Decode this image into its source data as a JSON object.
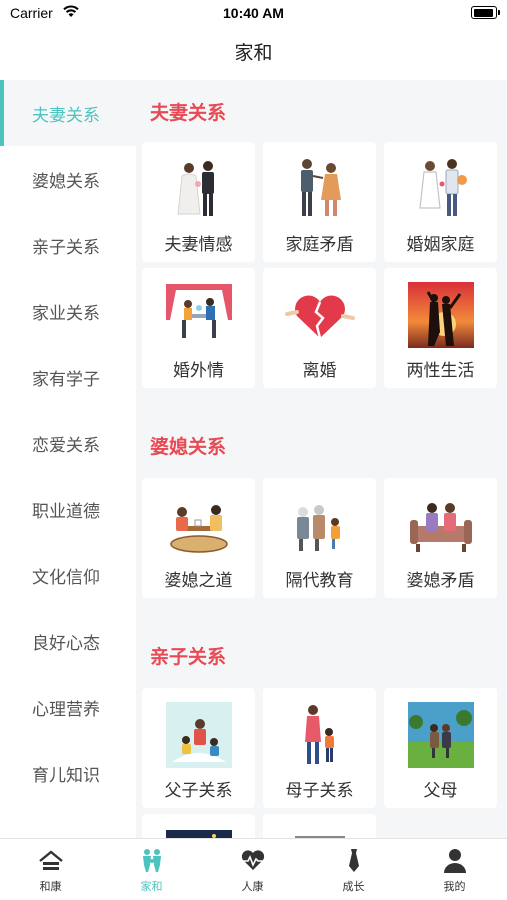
{
  "status": {
    "carrier": "Carrier",
    "time": "10:40 AM",
    "battery_level": 0.95
  },
  "nav": {
    "title": "家和"
  },
  "sidebar": {
    "active_index": 0,
    "items": [
      {
        "label": "夫妻关系"
      },
      {
        "label": "婆媳关系"
      },
      {
        "label": "亲子关系"
      },
      {
        "label": "家业关系"
      },
      {
        "label": "家有学子"
      },
      {
        "label": "恋爱关系"
      },
      {
        "label": "职业道德"
      },
      {
        "label": "文化信仰"
      },
      {
        "label": "良好心态"
      },
      {
        "label": "心理营养"
      },
      {
        "label": "育儿知识"
      }
    ]
  },
  "sections": [
    {
      "title": "夫妻关系",
      "items": [
        {
          "label": "夫妻情感",
          "icon": "wedding-couple-icon"
        },
        {
          "label": "家庭矛盾",
          "icon": "family-conflict-icon"
        },
        {
          "label": "婚姻家庭",
          "icon": "bride-groom-icon"
        },
        {
          "label": "婚外情",
          "icon": "affair-icon"
        },
        {
          "label": "离婚",
          "icon": "broken-heart-icon"
        },
        {
          "label": "两性生活",
          "icon": "sunset-couple-icon"
        }
      ]
    },
    {
      "title": "婆媳关系",
      "items": [
        {
          "label": "婆媳之道",
          "icon": "tea-table-icon"
        },
        {
          "label": "隔代教育",
          "icon": "grandparents-icon"
        },
        {
          "label": "婆媳矛盾",
          "icon": "sofa-women-icon"
        }
      ]
    },
    {
      "title": "亲子关系",
      "items": [
        {
          "label": "父子关系",
          "icon": "father-child-icon"
        },
        {
          "label": "母子关系",
          "icon": "mother-child-icon"
        },
        {
          "label": "父母",
          "icon": "parents-walk-icon"
        }
      ]
    }
  ],
  "tabbar": {
    "active_index": 1,
    "items": [
      {
        "label": "和康",
        "icon": "home-roof-icon"
      },
      {
        "label": "家和",
        "icon": "family-people-icon"
      },
      {
        "label": "人康",
        "icon": "heartbeat-icon"
      },
      {
        "label": "成长",
        "icon": "necktie-icon"
      },
      {
        "label": "我的",
        "icon": "user-profile-icon"
      }
    ]
  },
  "colors": {
    "accent": "#4cc3bf",
    "section_title": "#e84a55",
    "content_bg": "#f5f6f8"
  }
}
